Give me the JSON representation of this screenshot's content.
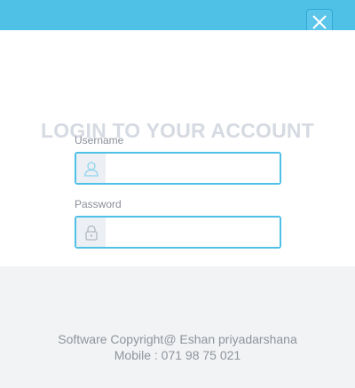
{
  "colors": {
    "accent": "#4fc0e6",
    "title_text": "#d6dae2",
    "footer_bg": "#f2f3f5"
  },
  "login": {
    "title": "LOGIN TO YOUR ACCOUNT",
    "username": {
      "label": "Username",
      "value": "",
      "icon": "user-icon"
    },
    "password": {
      "label": "Password",
      "value": "",
      "icon": "lock-icon"
    }
  },
  "window": {
    "close_icon": "close-icon"
  },
  "footer": {
    "copyright": "Software Copyright@ Eshan priyadarshana",
    "mobile": "Mobile : 071 98 75 021"
  }
}
